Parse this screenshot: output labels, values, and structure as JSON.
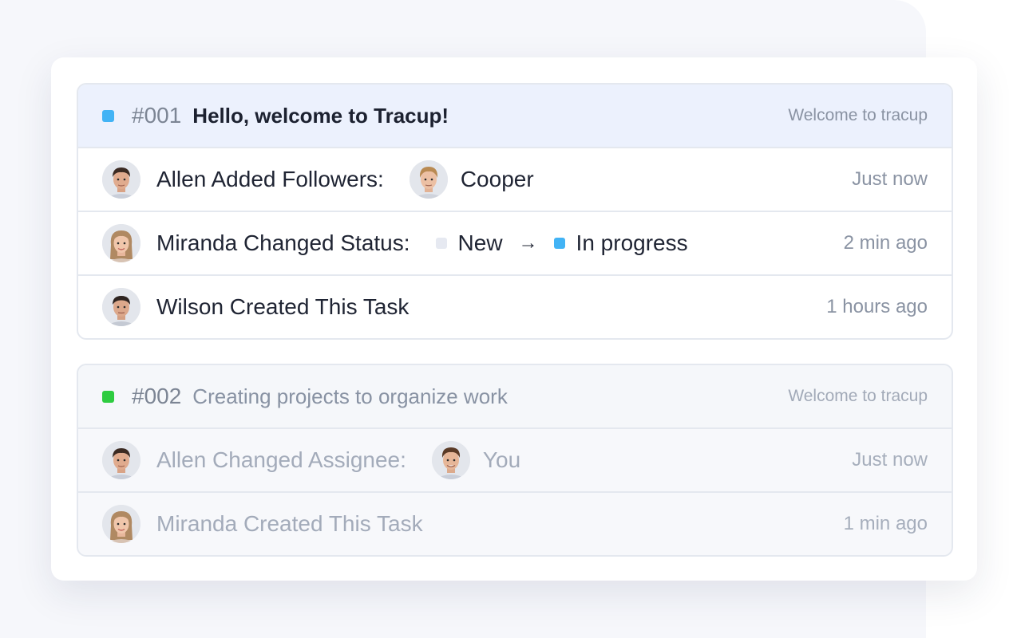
{
  "tasks": [
    {
      "number": "#001",
      "title": "Hello, welcome to Tracup!",
      "project": "Welcome to tracup",
      "status_color": "#42b3f5",
      "activities": [
        {
          "actor": "Allen",
          "text": "Allen Added Followers:",
          "target": "Cooper",
          "time": "Just now"
        },
        {
          "actor": "Miranda",
          "text": "Miranda Changed Status:",
          "status_from": "New",
          "status_from_color": "#e6e9f1",
          "arrow": "→",
          "status_to": "In progress",
          "status_to_color": "#42b3f5",
          "time": "2 min ago"
        },
        {
          "actor": "Wilson",
          "text": "Wilson Created This Task",
          "time": "1 hours ago"
        }
      ]
    },
    {
      "number": "#002",
      "title": "Creating projects to organize work",
      "project": "Welcome to tracup",
      "status_color": "#2ecc40",
      "activities": [
        {
          "actor": "Allen",
          "text": "Allen Changed Assignee:",
          "target": "You",
          "time": "Just now"
        },
        {
          "actor": "Miranda",
          "text": "Miranda Created This Task",
          "time": "1 min ago"
        }
      ]
    }
  ],
  "colors": {
    "accent_blue": "#42b3f5",
    "accent_green": "#2ecc40",
    "header_highlight": "#ecf1fd"
  }
}
